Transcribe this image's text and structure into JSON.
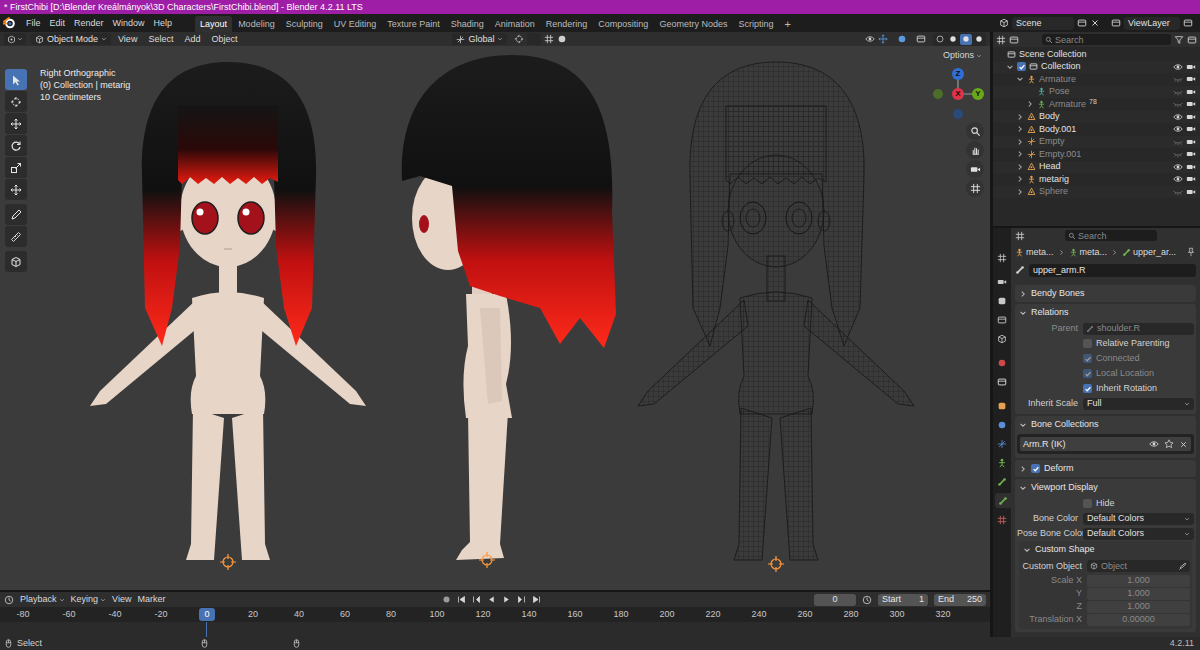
{
  "window": {
    "title": "* FirstChibi [D:\\Blender Kreálmányok\\3D Characters\\FirstChibi.blend] - Blender 4.2.11 LTS"
  },
  "menu": [
    "File",
    "Edit",
    "Render",
    "Window",
    "Help"
  ],
  "workspaces": [
    {
      "label": "Layout",
      "selected": true
    },
    {
      "label": "Modeling",
      "selected": false
    },
    {
      "label": "Sculpting",
      "selected": false
    },
    {
      "label": "UV Editing",
      "selected": false
    },
    {
      "label": "Texture Paint",
      "selected": false
    },
    {
      "label": "Shading",
      "selected": false
    },
    {
      "label": "Animation",
      "selected": false
    },
    {
      "label": "Rendering",
      "selected": false
    },
    {
      "label": "Compositing",
      "selected": false
    },
    {
      "label": "Geometry Nodes",
      "selected": false
    },
    {
      "label": "Scripting",
      "selected": false
    }
  ],
  "add_workspace": "+",
  "scene": "Scene",
  "view_layer": "ViewLayer",
  "viewport": {
    "mode": "Object Mode",
    "menus": [
      "View",
      "Select",
      "Add",
      "Object"
    ],
    "orientation": "Global",
    "options": "Options",
    "overlay": [
      "Right Orthographic",
      "(0) Collection | metarig",
      "10 Centimeters"
    ],
    "gizmo": [
      {
        "label": "Z",
        "color": "#2f6fd6"
      },
      {
        "label": "X",
        "color": "#e0334a"
      },
      {
        "label": "Y",
        "color": "#6aa81a"
      }
    ],
    "tools": [
      {
        "selected": true
      },
      {
        "selected": false
      },
      {
        "selected": false
      },
      {
        "selected": false
      },
      {
        "selected": false
      },
      {
        "selected": false
      },
      {
        "selected": false
      },
      {
        "selected": false
      },
      {
        "selected": false
      }
    ],
    "shading": [
      {
        "selected": false
      },
      {
        "selected": false
      },
      {
        "selected": true
      },
      {
        "selected": false
      }
    ]
  },
  "outliner": {
    "search": {
      "placeholder": "Search"
    },
    "items": [
      {
        "name": "Scene Collection",
        "kind": "scene",
        "hidden": false,
        "children": [
          {
            "name": "Collection",
            "kind": "collection",
            "expanded": true,
            "hidden": false,
            "checked": true,
            "children": [
              {
                "name": "Armature",
                "kind": "armature",
                "expanded": true,
                "hidden": true,
                "children": [
                  {
                    "name": "Pose",
                    "kind": "pose",
                    "hidden": true
                  },
                  {
                    "name": "Armature",
                    "kind": "armature_data",
                    "expanded": false,
                    "hidden": true,
                    "badge": "78"
                  }
                ]
              },
              {
                "name": "Body",
                "kind": "mesh",
                "expanded": false,
                "hidden": false
              },
              {
                "name": "Body.001",
                "kind": "mesh",
                "expanded": false,
                "hidden": false
              },
              {
                "name": "Empty",
                "kind": "empty",
                "expanded": false,
                "hidden": true
              },
              {
                "name": "Empty.001",
                "kind": "empty",
                "expanded": false,
                "hidden": true
              },
              {
                "name": "Head",
                "kind": "mesh",
                "expanded": false,
                "hidden": false
              },
              {
                "name": "metarig",
                "kind": "armature",
                "expanded": false,
                "hidden": false
              },
              {
                "name": "Sphere",
                "kind": "mesh",
                "expanded": false,
                "hidden": true
              }
            ]
          }
        ]
      }
    ]
  },
  "properties": {
    "search": {
      "placeholder": "Search"
    },
    "tabs": [
      {
        "selected": false
      },
      {
        "selected": false
      },
      {
        "selected": false
      },
      {
        "selected": false
      },
      {
        "selected": false
      },
      {
        "selected": false
      },
      {
        "selected": false
      },
      {
        "selected": false
      },
      {
        "selected": false
      },
      {
        "selected": false
      },
      {
        "selected": false
      },
      {
        "selected": false
      },
      {
        "selected": true
      },
      {
        "selected": false
      }
    ],
    "breadcrumb": [
      "meta...",
      "meta...",
      "upper_ar..."
    ],
    "bone_name": "upper_arm.R",
    "panels": [
      {
        "title": "Bendy Bones",
        "expanded": false,
        "rows": []
      },
      {
        "title": "Relations",
        "expanded": true,
        "rows": [
          {
            "kind": "field",
            "label": "Parent",
            "value": "shoulder.R",
            "disabled": true
          },
          {
            "kind": "checkbox",
            "label": "Relative Parenting",
            "checked": false,
            "disabled": false
          },
          {
            "kind": "checkbox",
            "label": "Connected",
            "checked": true,
            "disabled": true
          },
          {
            "kind": "checkbox",
            "label": "Local Location",
            "checked": true,
            "disabled": true
          },
          {
            "kind": "checkbox",
            "label": "Inherit Rotation",
            "checked": true,
            "disabled": false
          },
          {
            "kind": "dropdown",
            "label": "Inherit Scale",
            "value": "Full",
            "disabled": false
          }
        ]
      },
      {
        "title": "Bone Collections",
        "expanded": true,
        "rows": [
          {
            "kind": "list_item",
            "value": "Arm.R (IK)",
            "disabled": false
          }
        ]
      },
      {
        "title": "Deform",
        "expanded": false,
        "checked": true,
        "rows": []
      },
      {
        "title": "Viewport Display",
        "expanded": true,
        "rows": [
          {
            "kind": "checkbox",
            "label": "Hide",
            "checked": false,
            "disabled": false
          },
          {
            "kind": "dropdown",
            "label": "Bone Color",
            "value": "Default Colors",
            "disabled": false
          },
          {
            "kind": "dropdown",
            "label": "Pose Bone Color",
            "value": "Default Colors",
            "disabled": false
          }
        ],
        "subpanels": [
          {
            "title": "Custom Shape",
            "expanded": true,
            "rows": [
              {
                "kind": "object",
                "label": "Custom Object",
                "placeholder": "Object",
                "disabled": false
              },
              {
                "kind": "number",
                "label": "Scale X",
                "value": "1.000",
                "disabled": true
              },
              {
                "kind": "number",
                "label": "Y",
                "value": "1.000",
                "disabled": true
              },
              {
                "kind": "number",
                "label": "Z",
                "value": "1.000",
                "disabled": true
              },
              {
                "kind": "number",
                "label": "Translation X",
                "value": "0.00000",
                "disabled": true
              }
            ]
          }
        ]
      }
    ]
  },
  "timeline": {
    "menus": [
      "Playback",
      "Keying",
      "View",
      "Marker"
    ],
    "frame": "0",
    "start_label": "Start",
    "start": "1",
    "end_label": "End",
    "end": "250",
    "ruler": [
      {
        "label": "-80",
        "selected": false
      },
      {
        "label": "-60",
        "selected": false
      },
      {
        "label": "-40",
        "selected": false
      },
      {
        "label": "-20",
        "selected": false
      },
      {
        "label": "0",
        "selected": true
      },
      {
        "label": "20",
        "selected": false
      },
      {
        "label": "40",
        "selected": false
      },
      {
        "label": "60",
        "selected": false
      },
      {
        "label": "80",
        "selected": false
      },
      {
        "label": "100",
        "selected": false
      },
      {
        "label": "120",
        "selected": false
      },
      {
        "label": "140",
        "selected": false
      },
      {
        "label": "160",
        "selected": false
      },
      {
        "label": "180",
        "selected": false
      },
      {
        "label": "200",
        "selected": false
      },
      {
        "label": "220",
        "selected": false
      },
      {
        "label": "240",
        "selected": false
      },
      {
        "label": "260",
        "selected": false
      },
      {
        "label": "280",
        "selected": false
      },
      {
        "label": "300",
        "selected": false
      },
      {
        "label": "320",
        "selected": false
      }
    ]
  },
  "status_bar": {
    "left": "Select",
    "version": "4.2.11"
  }
}
